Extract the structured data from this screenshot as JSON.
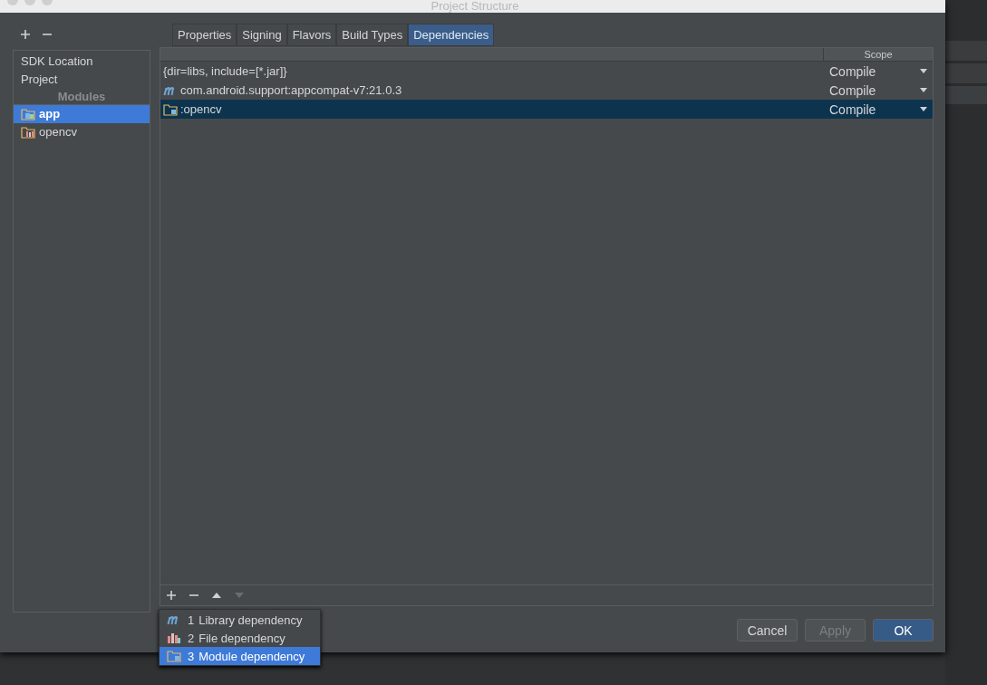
{
  "window": {
    "title": "Project Structure"
  },
  "sidebar": {
    "items": [
      {
        "label": "SDK Location",
        "selected": false
      },
      {
        "label": "Project",
        "selected": false
      }
    ],
    "modules_header": "Modules",
    "modules": [
      {
        "label": "app",
        "kind": "app",
        "selected": true
      },
      {
        "label": "opencv",
        "kind": "library",
        "selected": false
      }
    ]
  },
  "tabs": [
    {
      "label": "Properties",
      "selected": false
    },
    {
      "label": "Signing",
      "selected": false
    },
    {
      "label": "Flavors",
      "selected": false
    },
    {
      "label": "Build Types",
      "selected": false
    },
    {
      "label": "Dependencies",
      "selected": true
    }
  ],
  "table": {
    "columns": [
      "Scope"
    ],
    "rows": [
      {
        "name": "{dir=libs, include=[*.jar]}",
        "kind": "jar",
        "scope": "Compile",
        "selected": false
      },
      {
        "name": "com.android.support:appcompat-v7:21.0.3",
        "kind": "library",
        "scope": "Compile",
        "selected": false
      },
      {
        "name": ":opencv",
        "kind": "module",
        "scope": "Compile",
        "selected": true
      }
    ]
  },
  "toolbar": [
    {
      "kind": "add",
      "disabled": false
    },
    {
      "kind": "remove",
      "disabled": false
    },
    {
      "kind": "up",
      "disabled": false
    },
    {
      "kind": "down",
      "disabled": true
    }
  ],
  "add_menu": [
    {
      "number": "1",
      "label": "Library dependency",
      "kind": "library",
      "selected": false
    },
    {
      "number": "2",
      "label": "File dependency",
      "kind": "file",
      "selected": false
    },
    {
      "number": "3",
      "label": "Module dependency",
      "kind": "module",
      "selected": true
    }
  ],
  "buttons": [
    {
      "label": "Cancel",
      "disabled": false,
      "default": false
    },
    {
      "label": "Apply",
      "disabled": true,
      "default": false
    },
    {
      "label": "OK",
      "disabled": false,
      "default": true
    }
  ]
}
